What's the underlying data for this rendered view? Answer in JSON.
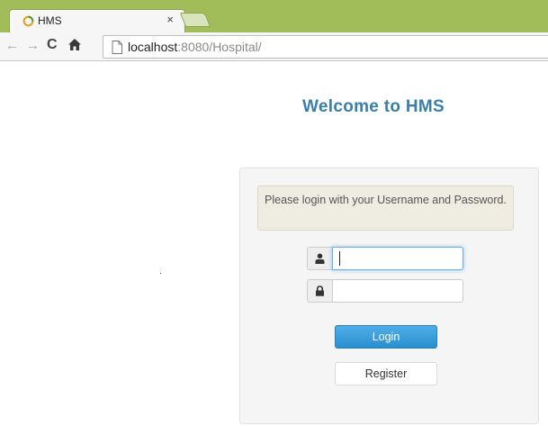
{
  "browser": {
    "tab_title": "HMS",
    "tab_close": "×",
    "url_host": "localhost",
    "url_rest": ":8080/Hospital/",
    "icons": {
      "back": "back-arrow-icon",
      "forward": "forward-arrow-icon",
      "reload": "reload-icon",
      "home": "home-icon",
      "page": "page-icon"
    },
    "colors": {
      "tabstrip": "#a1bd5a",
      "toolbar": "#f6f6f6"
    }
  },
  "page": {
    "heading": "Welcome to HMS",
    "alert_message": "Please login with your Username and Password.",
    "username": {
      "value": "",
      "icon": "user-icon"
    },
    "password": {
      "value": "",
      "icon": "lock-icon"
    },
    "login_label": "Login",
    "register_label": "Register",
    "colors": {
      "heading": "#3a7fa8",
      "login_button": "#2a8fd0",
      "alert_bg": "#efece1"
    }
  }
}
